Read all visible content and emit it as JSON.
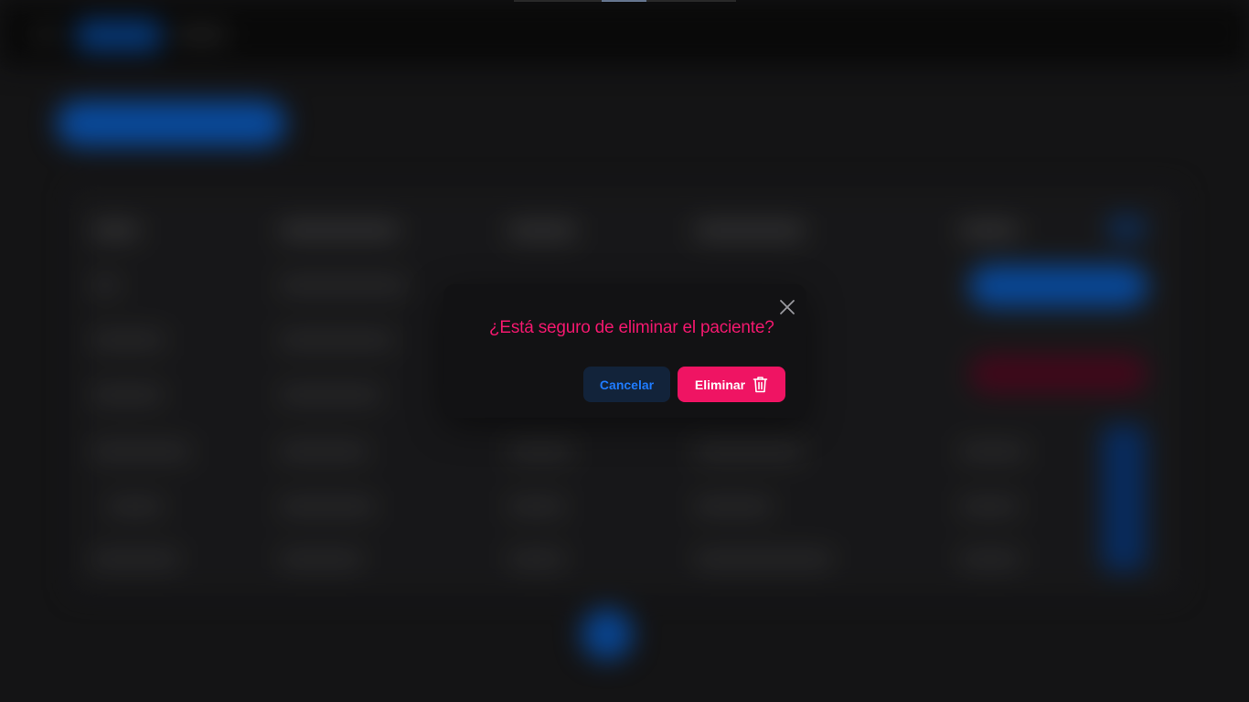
{
  "dialog": {
    "title": "¿Está seguro de eliminar el paciente?",
    "cancel_label": "Cancelar",
    "confirm_label": "Eliminar",
    "close_icon": "close-icon",
    "confirm_icon": "trash-icon"
  },
  "colors": {
    "accent_danger": "#ef1463",
    "accent_primary": "#1f7bff",
    "modal_bg": "#121214",
    "page_bg": "#1c1c1e"
  }
}
